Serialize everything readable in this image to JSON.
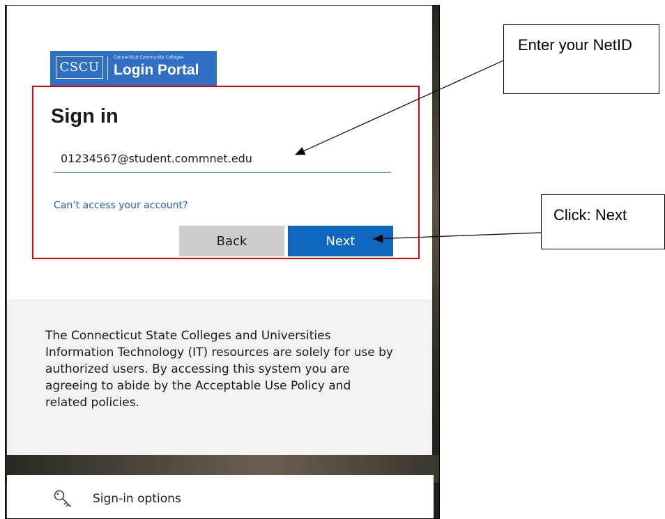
{
  "logo": {
    "abbr": "CSCU",
    "subtitle": "Connecticut Community Colleges",
    "title": "Login Portal"
  },
  "signin": {
    "title": "Sign in",
    "email_value": "01234567@student.commnet.edu",
    "cant_access_link": "Can’t access your account?",
    "back_label": "Back",
    "next_label": "Next"
  },
  "notice": {
    "text": "The Connecticut State Colleges and Universities Information Technology (IT) resources are solely for use by authorized users. By accessing this system you are agreeing to abide by the Acceptable Use Policy and related policies."
  },
  "options": {
    "label": "Sign-in options",
    "icon": "key-icon"
  },
  "callouts": {
    "netid": "Enter your NetID",
    "next": "Click: Next"
  },
  "colors": {
    "accent_blue": "#0f68c0",
    "logo_blue": "#2f6fc4",
    "highlight_red": "#e00000",
    "link_blue": "#1a62b3"
  }
}
